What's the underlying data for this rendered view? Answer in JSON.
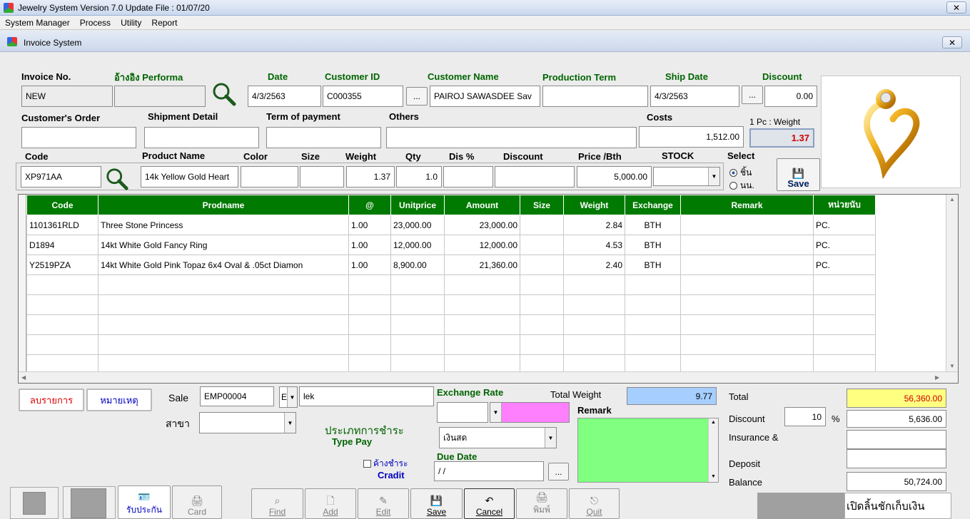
{
  "window": {
    "title": "Jewelry System Version 7.0 Update File : 01/07/20"
  },
  "menu": [
    "System Manager",
    "Process",
    "Utility",
    "Report"
  ],
  "inner_window": {
    "title": "Invoice System"
  },
  "header": {
    "invoice_no_label": "Invoice No.",
    "invoice_no": "NEW",
    "ref_performa_label": "อ้างอิง Performa",
    "ref_performa": "",
    "date_label": "Date",
    "date": "4/3/2563",
    "customer_id_label": "Customer ID",
    "customer_id": "C000355",
    "customer_name_label": "Customer Name",
    "customer_name": "PAIROJ  SAWASDEE Sav",
    "production_term_label": "Production Term",
    "production_term": "",
    "ship_date_label": "Ship Date",
    "ship_date": "4/3/2563",
    "discount_label": "Discount",
    "discount": "0.00",
    "customers_order_label": "Customer's Order",
    "customers_order": "",
    "shipment_detail_label": "Shipment Detail",
    "shipment_detail": "",
    "term_of_payment_label": "Term of payment",
    "term_of_payment": "",
    "others_label": "Others",
    "others": "",
    "costs_label": "Costs",
    "costs": "1,512.00",
    "pc_weight_label": "1 Pc : Weight",
    "pc_weight": "1.37",
    "ellipsis": "..."
  },
  "product": {
    "code_label": "Code",
    "code": "XP971AA",
    "name_label": "Product Name",
    "name": "14k Yellow Gold Heart",
    "color_label": "Color",
    "color": "",
    "size_label": "Size",
    "size": "",
    "weight_label": "Weight",
    "weight": "1.37",
    "qty_label": "Qty",
    "qty": "1.0",
    "dis_pct_label": "Dis %",
    "dis_pct": "",
    "discount_label": "Discount",
    "discount": "",
    "price_label": "Price /Bth",
    "price": "5,000.00",
    "stock_label": "STOCK",
    "stock": "",
    "select_label": "Select",
    "opt_piece": "ชิ้น",
    "opt_weight": "นน.",
    "save_label": "Save"
  },
  "grid": {
    "columns": [
      "Code",
      "Prodname",
      "@",
      "Unitprice",
      "Amount",
      "Size",
      "Weight",
      "Exchange",
      "Remark",
      "หน่วยนับ"
    ],
    "rows": [
      [
        "1101361RLD",
        "Three Stone Princess",
        "1.00",
        "23,000.00",
        "23,000.00",
        "",
        "2.84",
        "BTH",
        "",
        "PC."
      ],
      [
        "D1894",
        "14kt White Gold Fancy Ring",
        "1.00",
        "12,000.00",
        "12,000.00",
        "",
        "4.53",
        "BTH",
        "",
        "PC."
      ],
      [
        "Y2519PZA",
        "14kt White Gold Pink Topaz 6x4 Oval & .05ct Diamon",
        "1.00",
        "8,900.00",
        "21,360.00",
        "",
        "2.40",
        "BTH",
        "",
        "PC."
      ]
    ]
  },
  "bottom": {
    "delete_item": "ลบรายการ",
    "note": "หมายเหตุ",
    "sale_label": "Sale",
    "sale_id": "EMP00004",
    "sale_code": "E",
    "sale_name": "lek",
    "branch_label": "สาขา",
    "branch": "",
    "pay_type_th": "ประเภทการชำระ",
    "pay_type_en": "Type Pay",
    "credit_th": "ค้างชำระ",
    "credit_en": "Cradit",
    "exchange_rate_label": "Exchange Rate",
    "exchange_rate": "",
    "pay_method": "เงินสด",
    "due_date_label": "Due Date",
    "due_date": " /  /",
    "total_weight_label": "Total Weight",
    "total_weight": "9.77",
    "remark_label": "Remark",
    "total_label": "Total",
    "total": "56,360.00",
    "discount_label": "Discount",
    "discount_pct": "10",
    "pct_sign": "%",
    "discount_amt": "5,636.00",
    "insurance_label": "Insurance &",
    "insurance": "",
    "deposit_label": "Deposit",
    "deposit": "",
    "balance_label": "Balance",
    "balance": "50,724.00",
    "open_drawer": "เปิดลิ้นชักเก็บเงิน"
  },
  "toolbar": {
    "receive": "รับประกัน",
    "card": "Card",
    "find": "Find",
    "add": "Add",
    "edit": "Edit",
    "save": "Save",
    "cancel": "Cancel",
    "print": "พิมพ์",
    "quit": "Quit"
  },
  "colors": {
    "grid_header": "#007a00",
    "total_bg": "#ffff80",
    "remark_bg": "#80ff80",
    "pink": "#ff80ff",
    "weight_bg": "#a6cfff",
    "red_text": "#d00000"
  }
}
